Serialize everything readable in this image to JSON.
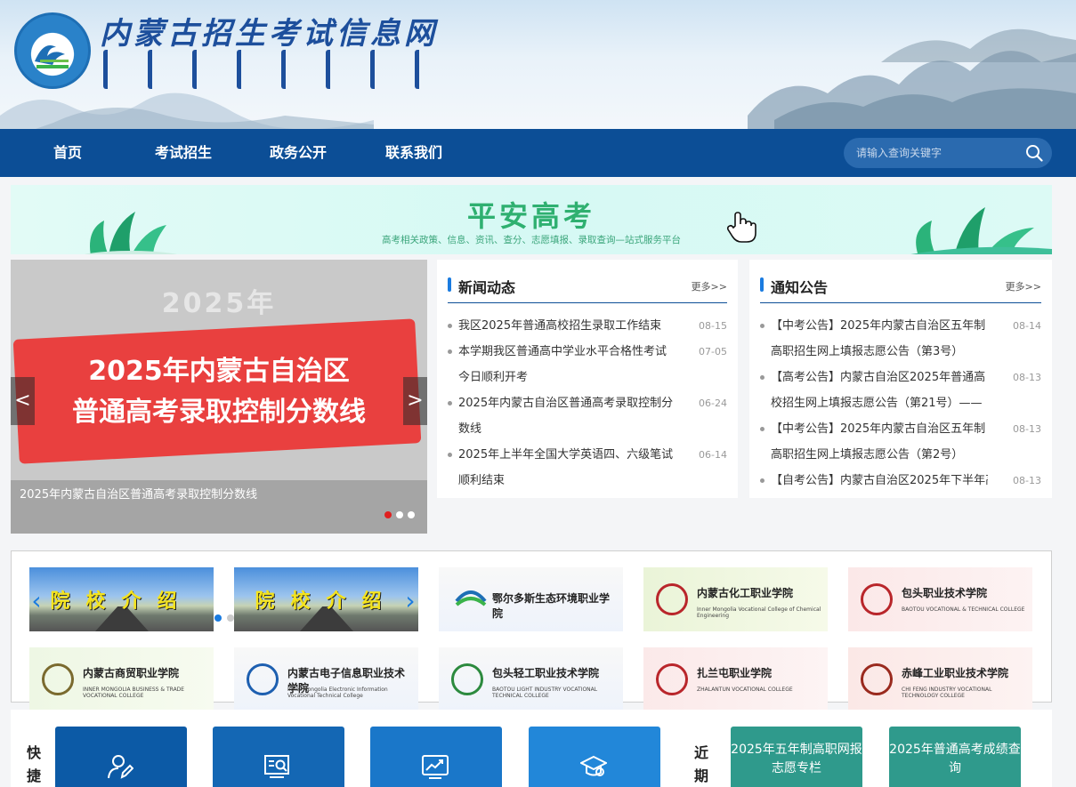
{
  "header": {
    "site_title": "内蒙古招生考试信息网",
    "mongolian_script": "ᠥᠪᠦᠷ ᠮᠣᠩᠭᠣᠯ"
  },
  "nav": {
    "items": [
      {
        "label": "首页"
      },
      {
        "label": "考试招生"
      },
      {
        "label": "政务公开"
      },
      {
        "label": "联系我们"
      }
    ],
    "search_placeholder": "请输入查询关键字"
  },
  "banner": {
    "title": "平安高考",
    "subtitle": "高考相关政策、信息、资讯、查分、志愿填报、录取查询—站式服务平台"
  },
  "carousel": {
    "year": "2025年",
    "line1": "2025年内蒙古自治区",
    "line2": "普通高考录取控制分数线",
    "caption": "2025年内蒙古自治区普通高考录取控制分数线",
    "prev": "<",
    "next": ">"
  },
  "news": {
    "title": "新闻动态",
    "more": "更多>>",
    "items": [
      {
        "text": "我区2025年普通高校招生录取工作结束",
        "date": "08-15"
      },
      {
        "text": "本学期我区普通高中学业水平合格性考试今日顺利开考",
        "date": "07-05"
      },
      {
        "text": "2025年内蒙古自治区普通高考录取控制分数线",
        "date": "06-24"
      },
      {
        "text": "2025年上半年全国大学英语四、六级笔试顺利结束",
        "date": "06-14"
      }
    ]
  },
  "notices": {
    "title": "通知公告",
    "more": "更多>>",
    "items": [
      {
        "text": "【中考公告】2025年内蒙古自治区五年制高职招生网上填报志愿公告（第3号）",
        "date": "08-14"
      },
      {
        "text": "【高考公告】内蒙古自治区2025年普通高校招生网上填报志愿公告（第21号）——高...",
        "date": "08-13"
      },
      {
        "text": "【中考公告】2025年内蒙古自治区五年制高职招生网上填报志愿公告（第2号）",
        "date": "08-13"
      },
      {
        "text": "【自考公告】内蒙古自治区2025年下半年高",
        "date": "08-13"
      }
    ]
  },
  "schools": {
    "intro_label": "院校介绍",
    "items": [
      {
        "name": "鄂尔多斯生态环境职业学院",
        "english": ""
      },
      {
        "name": "内蒙古化工职业学院",
        "english": "Inner Mongolia Vocational College of Chemical Engineering"
      },
      {
        "name": "包头职业技术学院",
        "english": "BAOTOU VOCATIONAL & TECHNICAL COLLEGE"
      },
      {
        "name": "内蒙古商贸职业学院",
        "english": "INNER MONGOLIA BUSINESS & TRADE VOCATIONAL COLLEGE"
      },
      {
        "name": "内蒙古电子信息职业技术学院",
        "english": "Inner Mongolia Electronic Information Vocational Technical College"
      },
      {
        "name": "包头轻工职业技术学院",
        "english": "BAOTOU LIGHT INDUSTRY VOCATIONAL TECHNICAL COLLEGE"
      },
      {
        "name": "扎兰屯职业学院",
        "english": "ZHALANTUN VOCATIONAL COLLEGE"
      },
      {
        "name": "赤峰工业职业技术学院",
        "english": "CHI FENG INDUSTRY VOCATIONAL TECHNOLOGY COLLEGE"
      }
    ]
  },
  "quick": {
    "label": "快捷",
    "buttons": [
      {
        "icon": "user-edit-icon",
        "color": "#0c5aa6"
      },
      {
        "icon": "search-screen-icon",
        "color": "#1467b4"
      },
      {
        "icon": "chart-screen-icon",
        "color": "#1a77c9"
      },
      {
        "icon": "graduation-cap-icon",
        "color": "#2287d9"
      }
    ],
    "recent_label": "近期",
    "recent": [
      {
        "label": "2025年五年制高职网报志愿专栏"
      },
      {
        "label": "2025年普通高考成绩查询"
      }
    ]
  }
}
